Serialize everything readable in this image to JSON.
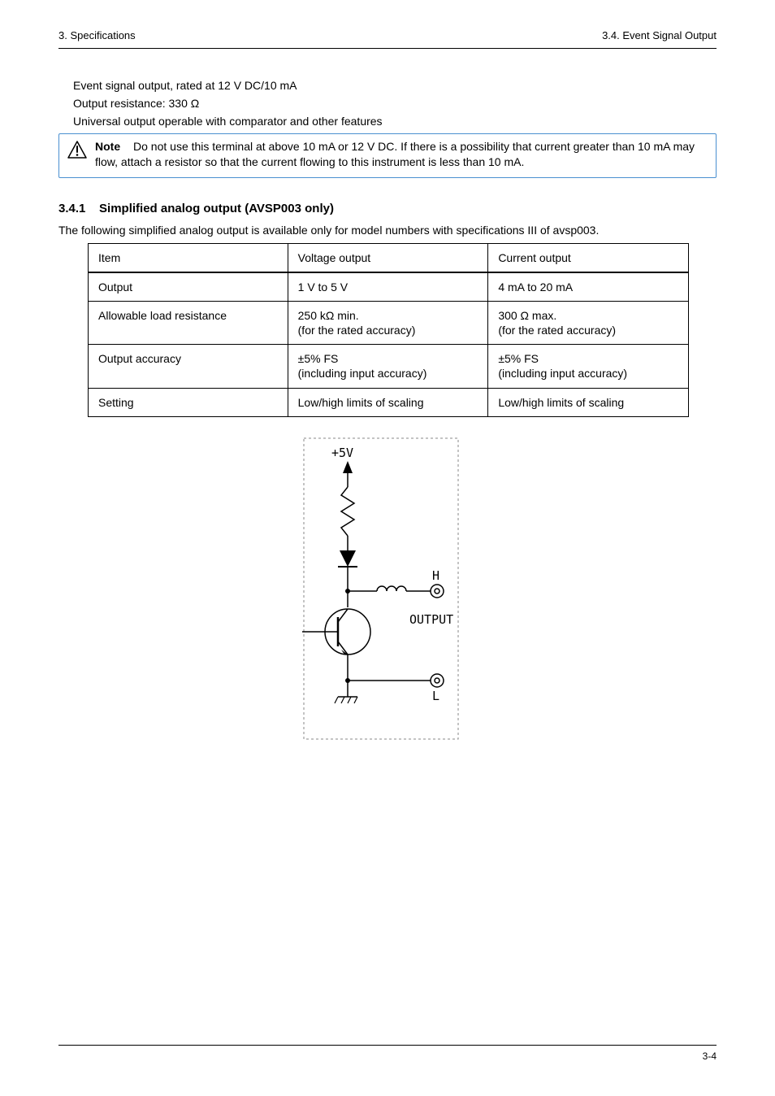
{
  "header": {
    "left": "3. Specifications",
    "right": "3.4. Event Signal Output"
  },
  "intro": {
    "line1": "Event signal output, rated at 12 V DC/10 mA",
    "line2": "Output resistance: 330 Ω",
    "line3": "Universal output operable with comparator and other features"
  },
  "note": {
    "label": "Note",
    "text": "Do not use this terminal at above 10 mA or 12 V DC. If there is a possibility that current greater than 10 mA may flow, attach a resistor so that the current flowing to this instrument is less than 10 mA."
  },
  "section_num_title": {
    "num": "3.4.1",
    "title": "Simplified analog output (AVSP003 only)"
  },
  "section_body": "The following simplified analog output is available only for model numbers with specifications III of avsp003.",
  "table": {
    "headers": [
      "Item",
      "Voltage output",
      "Current output"
    ],
    "rows": [
      {
        "item": "Output",
        "volt": "1 V to 5 V",
        "curr": "4 mA to 20 mA"
      },
      {
        "item": "Allowable load resistance",
        "volt": "250 kΩ min.\n(for the rated accuracy)",
        "curr": "300 Ω max.\n(for the rated accuracy)"
      },
      {
        "item": "Output accuracy",
        "volt": "±5% FS\n(including input accuracy)",
        "curr": "±5% FS\n(including input accuracy)"
      },
      {
        "item": "Setting",
        "volt": "Low/high limits of scaling",
        "curr": "Low/high limits of scaling"
      }
    ]
  },
  "diagram": {
    "label_5v": "+5V",
    "label_H": "H",
    "label_L": "L",
    "label_output": "OUTPUT"
  },
  "footer": {
    "left": "",
    "right": "3-4"
  }
}
